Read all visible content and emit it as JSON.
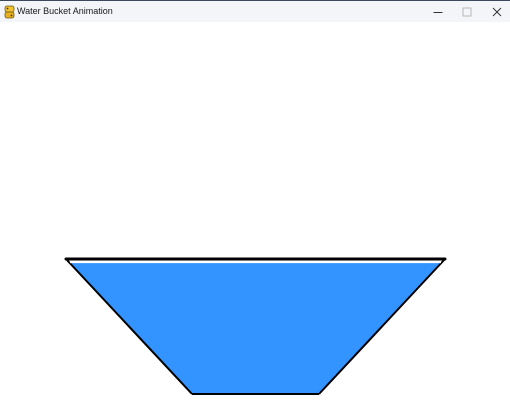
{
  "window": {
    "title": "Water Bucket Animation",
    "icon": "python-icon",
    "controls": {
      "minimize_icon": "minimize-icon",
      "maximize_icon": "maximize-icon",
      "close_icon": "close-icon"
    }
  },
  "scene": {
    "background_color": "#ffffff",
    "water_color": "#3393ff",
    "bucket_outline_color": "#000000",
    "water_fill_level": 1.0
  }
}
